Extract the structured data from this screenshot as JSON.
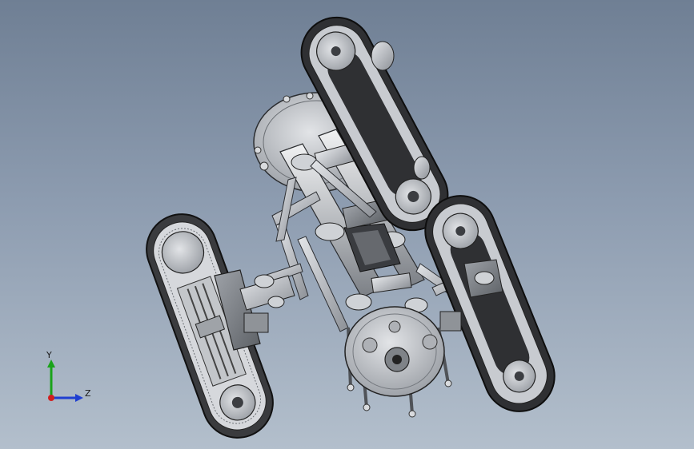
{
  "viewport": {
    "background_top": "#6f7f94",
    "background_bottom": "#b3bfcc"
  },
  "triad": {
    "y_label": "Y",
    "z_label": "Z",
    "y_color": "#1aa31a",
    "z_color": "#1f3fd1",
    "x_color": "#d11f1f"
  },
  "model": {
    "description_icon": "robot-assembly-icon"
  }
}
